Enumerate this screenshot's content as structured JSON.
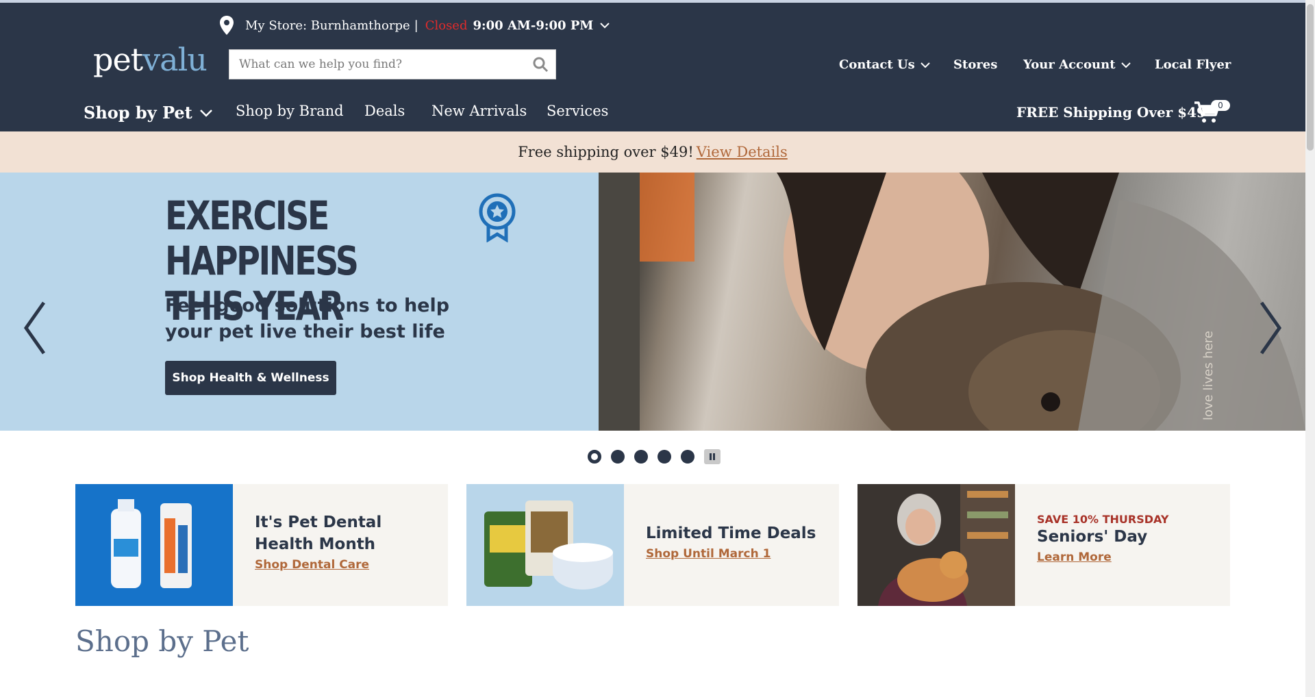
{
  "header": {
    "store_label": "My Store: Burnhamthorpe",
    "store_separator": "|",
    "store_status": "Closed",
    "store_hours": "9:00 AM-9:00 PM",
    "logo_pet": "pet",
    "logo_valu": "valu",
    "search_placeholder": "What can we help you find?",
    "links": {
      "contact": "Contact Us",
      "stores": "Stores",
      "account": "Your Account",
      "flyer": "Local Flyer"
    },
    "nav": {
      "shop_by_pet": "Shop by Pet",
      "shop_by_brand": "Shop by Brand",
      "deals": "Deals",
      "new_arrivals": "New Arrivals",
      "services": "Services"
    },
    "free_shipping": "FREE Shipping Over $49",
    "cart_count": "0"
  },
  "promo": {
    "text": "Free shipping over $49!",
    "link": "View Details"
  },
  "hero": {
    "title_line1": "EXERCISE HAPPINESS",
    "title_line2": "THIS YEAR",
    "subtitle_line1": "Feel-good solutions to help",
    "subtitle_line2": "your pet live their best life",
    "button": "Shop Health & Wellness",
    "tagline": "love lives here",
    "slide_count": 5,
    "active_slide": 1
  },
  "cards": [
    {
      "title_line1": "It's Pet Dental",
      "title_line2": "Health Month",
      "link": "Shop Dental Care"
    },
    {
      "title": "Limited Time Deals",
      "link": "Shop Until March 1"
    },
    {
      "kicker": "SAVE 10% THURSDAY",
      "title": "Seniors' Day",
      "link": "Learn More"
    }
  ],
  "section_title": "Shop by Pet",
  "colors": {
    "header_bg": "#2b3648",
    "promo_bg": "#f2e1d4",
    "hero_bg": "#b9d6ea",
    "accent_link": "#b0683a",
    "closed_red": "#e12b2b"
  }
}
